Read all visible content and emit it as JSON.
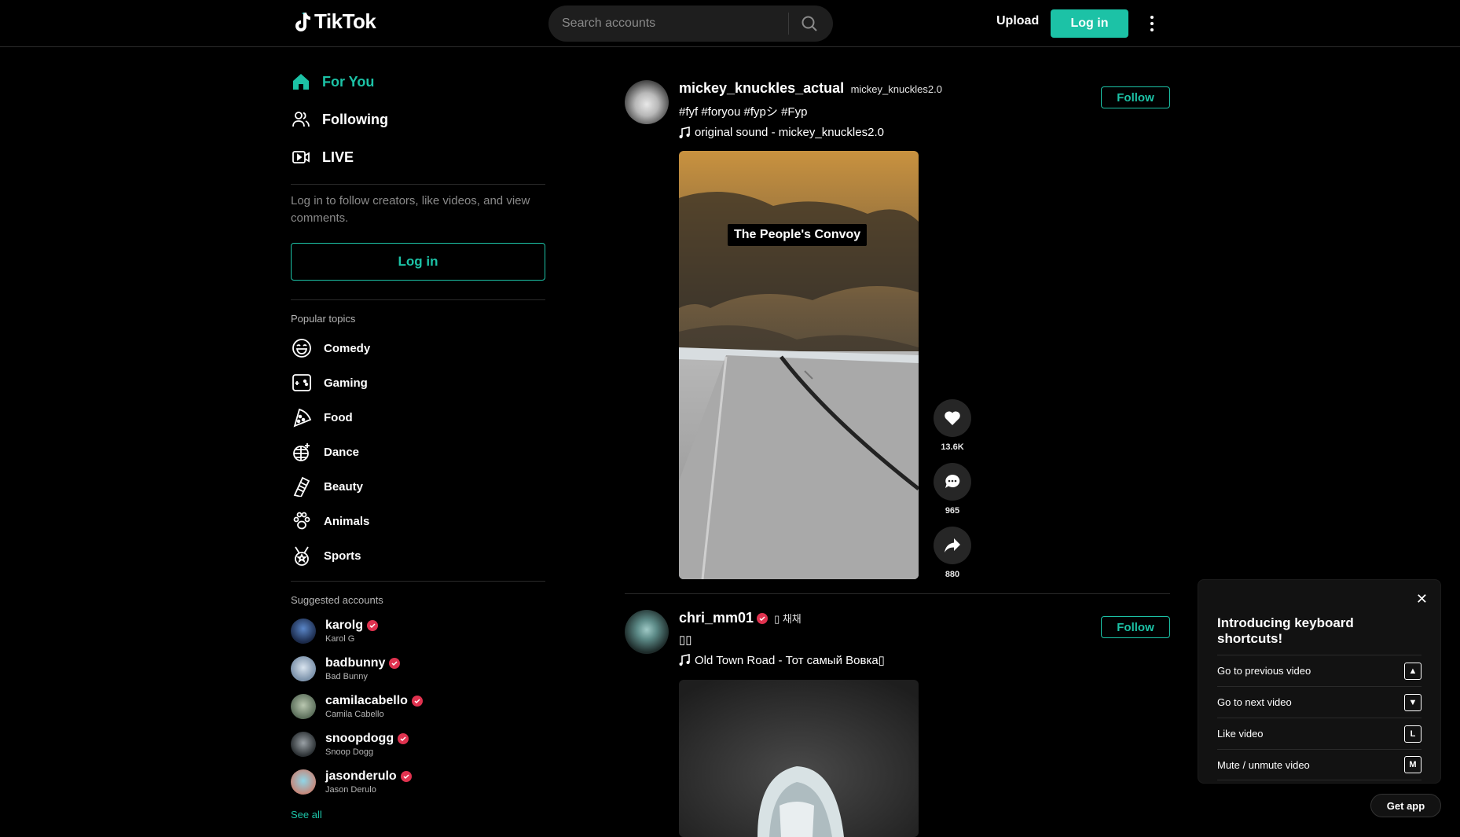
{
  "header": {
    "logo_text": "TikTok",
    "search_placeholder": "Search accounts",
    "upload_label": "Upload",
    "login_label": "Log in"
  },
  "sidebar": {
    "nav": [
      {
        "label": "For You",
        "icon": "home-icon"
      },
      {
        "label": "Following",
        "icon": "users-icon"
      },
      {
        "label": "LIVE",
        "icon": "live-icon"
      }
    ],
    "login_hint": "Log in to follow creators, like videos, and view comments.",
    "login_button": "Log in",
    "popular_title": "Popular topics",
    "topics": [
      {
        "label": "Comedy",
        "icon": "comedy-icon"
      },
      {
        "label": "Gaming",
        "icon": "gaming-icon"
      },
      {
        "label": "Food",
        "icon": "food-icon"
      },
      {
        "label": "Dance",
        "icon": "dance-icon"
      },
      {
        "label": "Beauty",
        "icon": "beauty-icon"
      },
      {
        "label": "Animals",
        "icon": "animals-icon"
      },
      {
        "label": "Sports",
        "icon": "sports-icon"
      }
    ],
    "suggested_title": "Suggested accounts",
    "accounts": [
      {
        "username": "karolg",
        "name": "Karol G"
      },
      {
        "username": "badbunny",
        "name": "Bad Bunny"
      },
      {
        "username": "camilacabello",
        "name": "Camila Cabello"
      },
      {
        "username": "snoopdogg",
        "name": "Snoop Dogg"
      },
      {
        "username": "jasonderulo",
        "name": "Jason Derulo"
      }
    ],
    "see_all": "See all"
  },
  "posts": [
    {
      "username": "mickey_knuckles_actual",
      "nickname": "mickey_knuckles2.0",
      "caption": "#fyf #foryou #fypシ #Fyp",
      "music": "original sound - mickey_knuckles2.0",
      "follow_label": "Follow",
      "overlay_text": "The People's Convoy",
      "likes": "13.6K",
      "comments": "965",
      "shares": "880"
    },
    {
      "username": "chri_mm01",
      "nickname": "▯ 채채",
      "caption": "▯▯",
      "music": "Old Town Road - Тот самый Вовка▯",
      "follow_label": "Follow"
    }
  ],
  "shortcuts": {
    "title": "Introducing keyboard shortcuts!",
    "items": [
      {
        "label": "Go to previous video",
        "key": "▲"
      },
      {
        "label": "Go to next video",
        "key": "▼"
      },
      {
        "label": "Like video",
        "key": "L"
      },
      {
        "label": "Mute / unmute video",
        "key": "M"
      }
    ]
  },
  "get_app": "Get app",
  "colors": {
    "accent": "#1cc2a6",
    "verified": "#e0324f",
    "background": "#000000"
  }
}
